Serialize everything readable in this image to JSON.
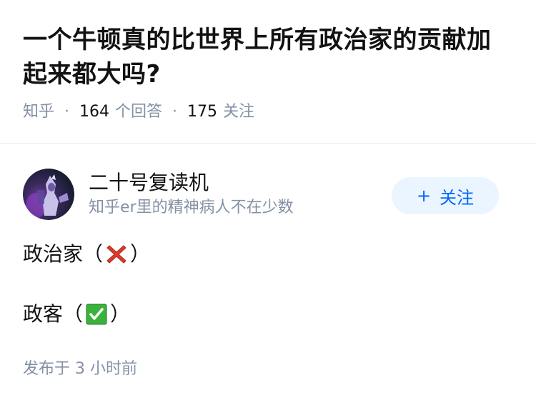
{
  "question": {
    "title": "一个牛顿真的比世界上所有政治家的贡献加起来都大吗?",
    "meta": {
      "site": "知乎",
      "answer_count": "164",
      "answer_label": "个回答",
      "follower_count": "175",
      "follower_label": "关注"
    }
  },
  "answer": {
    "author": {
      "name": "二十号复读机",
      "bio": "知乎er里的精神病人不在少数"
    },
    "follow_button": {
      "plus": "+",
      "label": "关注"
    },
    "content": {
      "line1_prefix": "政治家（",
      "line1_emoji": "cross-mark-icon",
      "line1_suffix": "）",
      "line2_prefix": "政客（",
      "line2_emoji": "check-mark-button-icon",
      "line2_suffix": "）"
    },
    "time": "发布于 3 小时前"
  },
  "colors": {
    "link_blue": "#0066ff",
    "follow_bg": "#ebf5ff",
    "meta_gray": "#8590a6",
    "cross_red": "#dd3b2b",
    "check_green": "#3bb23b"
  }
}
